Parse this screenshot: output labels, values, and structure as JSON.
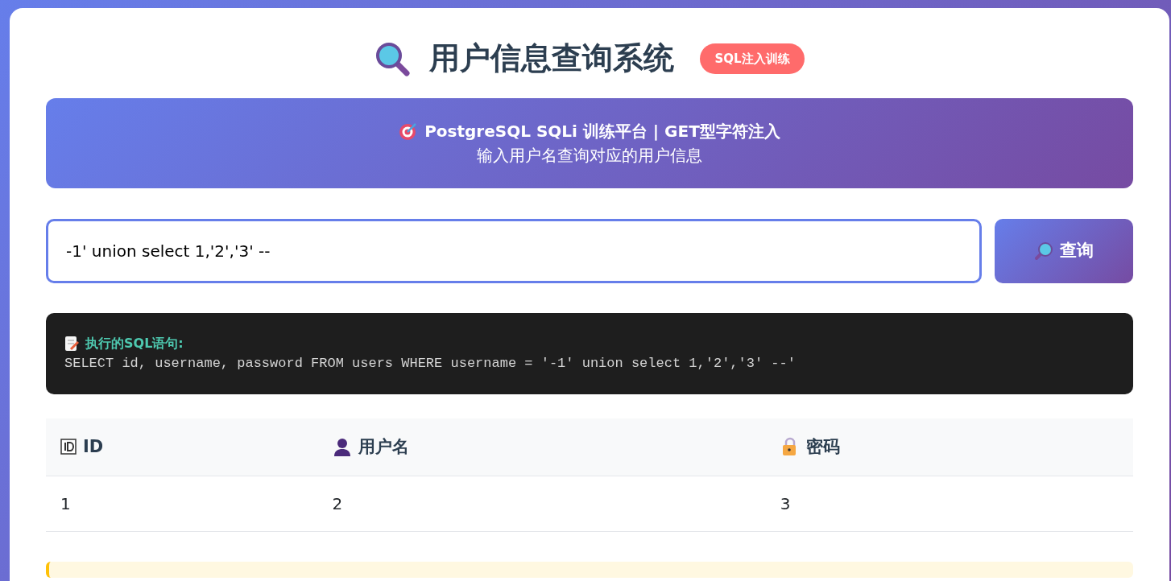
{
  "header": {
    "title": "用户信息查询系统",
    "badge": "SQL注入训练"
  },
  "banner": {
    "title": "PostgreSQL SQLi 训练平台 | GET型字符注入",
    "subtitle": "输入用户名查询对应的用户信息"
  },
  "search": {
    "value": "-1' union select 1,'2','3' --",
    "focused": true,
    "button": "查询"
  },
  "sql_box": {
    "label": "执行的SQL语句:",
    "query": "SELECT id, username, password FROM users WHERE username = '-1' union select 1,'2','3' --'"
  },
  "table": {
    "columns": [
      "ID",
      "用户名",
      "密码"
    ],
    "rows": [
      [
        "1",
        "2",
        "3"
      ]
    ]
  }
}
